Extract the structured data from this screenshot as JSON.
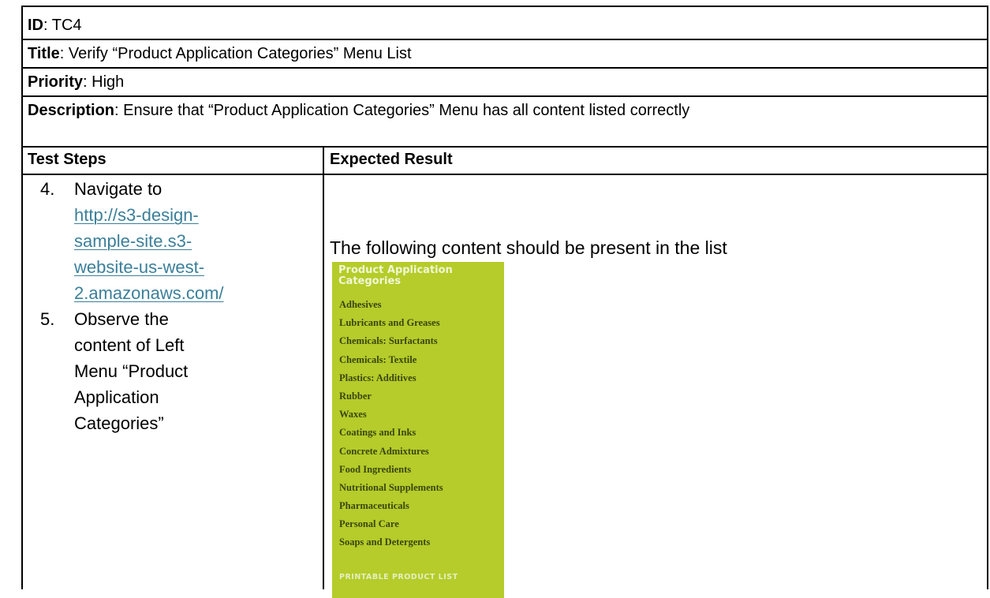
{
  "fields": {
    "id_label": "ID",
    "id_value": ": TC4",
    "title_label": "Title",
    "title_value": ": Verify “Product Application Categories” Menu List",
    "priority_label": "Priority",
    "priority_value": ": High",
    "description_label": "Description",
    "description_value": ": Ensure that “Product Application Categories” Menu has all content listed correctly"
  },
  "columns": {
    "steps": "Test Steps",
    "expected": "Expected Result"
  },
  "steps": {
    "step4_num": "4.",
    "step4_text": "Navigate to",
    "step4_link_lines": [
      "http://s3-design-",
      "sample-site.s3-",
      "website-us-west-",
      "2.amazonaws.com/"
    ],
    "step5_num": "5.",
    "step5_lines": [
      "Observe the",
      "content of Left",
      "Menu “Product",
      "Application",
      "Categories”"
    ]
  },
  "expected_text": "The following content should be present in the list",
  "menu": {
    "title": "Product Application Categories",
    "items": [
      "Adhesives",
      "Lubricants and Greases",
      "Chemicals: Surfactants",
      "Chemicals: Textile",
      "Plastics: Additives",
      "Rubber",
      "Waxes",
      "Coatings and Inks",
      "Concrete Admixtures",
      "Food Ingredients",
      "Nutritional Supplements",
      "Pharmaceuticals",
      "Personal Care",
      "Soaps and Detergents"
    ],
    "footer": "PRINTABLE PRODUCT LIST",
    "background": "#b5cc2a"
  },
  "colors": {
    "link": "#3b7f9a",
    "border": "#000000"
  }
}
